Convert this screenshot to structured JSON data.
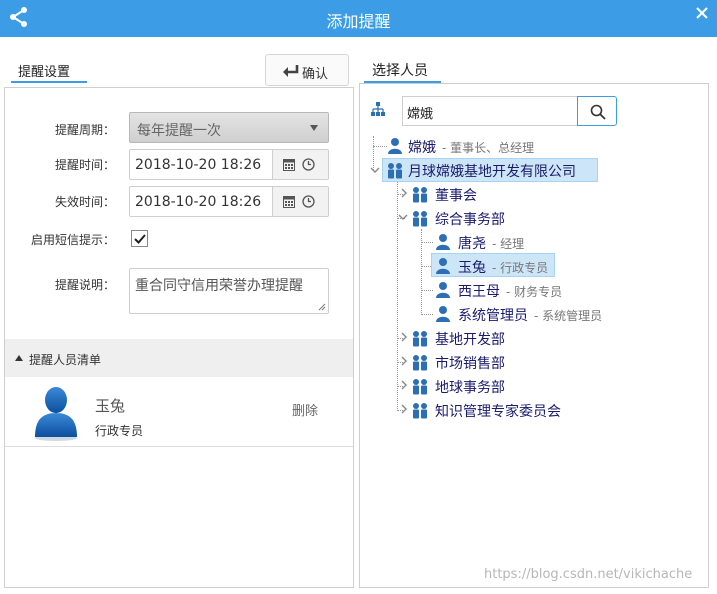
{
  "dialog": {
    "title": "添加提醒"
  },
  "left": {
    "tab_label": "提醒设置",
    "confirm_label": "确认",
    "fields": {
      "period_label": "提醒周期：",
      "period_value": "每年提醒一次",
      "remind_time_label": "提醒时间：",
      "remind_time_value": "2018-10-20 18:26",
      "expire_time_label": "失效时间：",
      "expire_time_value": "2018-10-20 18:26",
      "sms_label": "启用短信提示：",
      "sms_checked": true,
      "note_label": "提醒说明：",
      "note_value": "重合同守信用荣誉办理提醒"
    },
    "list": {
      "header": "提醒人员清单",
      "items": [
        {
          "name": "玉兔",
          "title": "行政专员",
          "delete_label": "删除"
        }
      ]
    }
  },
  "right": {
    "tab_label": "选择人员",
    "search_value": "嫦娥",
    "tree": {
      "root_person": {
        "name": "嫦娥",
        "title": "- 董事长、总经理"
      },
      "company": "月球嫦娥基地开发有限公司",
      "depts": [
        {
          "name": "董事会"
        },
        {
          "name": "综合事务部",
          "members": [
            {
              "name": "唐尧",
              "title": "- 经理"
            },
            {
              "name": "玉兔",
              "title": "- 行政专员"
            },
            {
              "name": "西王母",
              "title": "- 财务专员"
            },
            {
              "name": "系统管理员",
              "title": "- 系统管理员"
            }
          ]
        },
        {
          "name": "基地开发部"
        },
        {
          "name": "市场销售部"
        },
        {
          "name": "地球事务部"
        },
        {
          "name": "知识管理专家委员会"
        }
      ]
    }
  },
  "watermark": "https://blog.csdn.net/vikichache",
  "colors": {
    "accent": "#3c9de6",
    "highlight": "#cde6f7",
    "icon_blue": "#2d6fb4"
  }
}
